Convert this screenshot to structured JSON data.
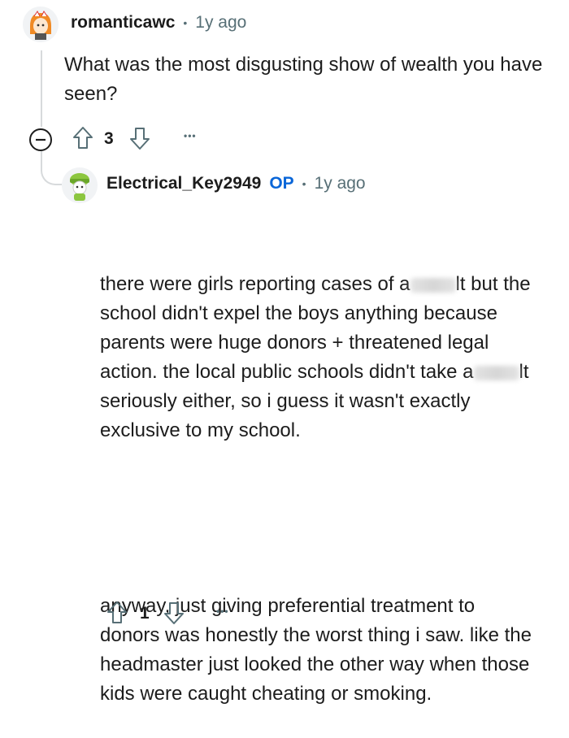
{
  "comment": {
    "username": "romanticawc",
    "separator": "•",
    "time": "1y ago",
    "text": "What was the most disgusting show of wealth you have seen?",
    "vote_count": "3",
    "more": "•••"
  },
  "reply": {
    "username": "Electrical_Key2949",
    "op_badge": "OP",
    "separator": "•",
    "time": "1y ago",
    "p1_a": "there were girls reporting cases of a",
    "p1_b": "lt but the school didn't expel the boys anything because parents were huge donors + threatened legal action. the local public schools didn't take a",
    "p1_c": "lt seriously either, so i guess it wasn't exactly exclusive to my school.",
    "p2": "anyway, just giving preferential treatment to donors was honestly the worst thing i saw. like the headmaster just looked the other way when those kids were caught cheating or smoking.",
    "vote_count": "1",
    "more": "•••"
  },
  "icons": {
    "collapse": "minus-circle-icon",
    "upvote": "arrow-up-icon",
    "downvote": "arrow-down-icon",
    "more": "ellipsis-icon"
  },
  "colors": {
    "text": "#1c1c1c",
    "meta": "#576f76",
    "op": "#0a66d8",
    "thread_line": "#d7dadc"
  }
}
